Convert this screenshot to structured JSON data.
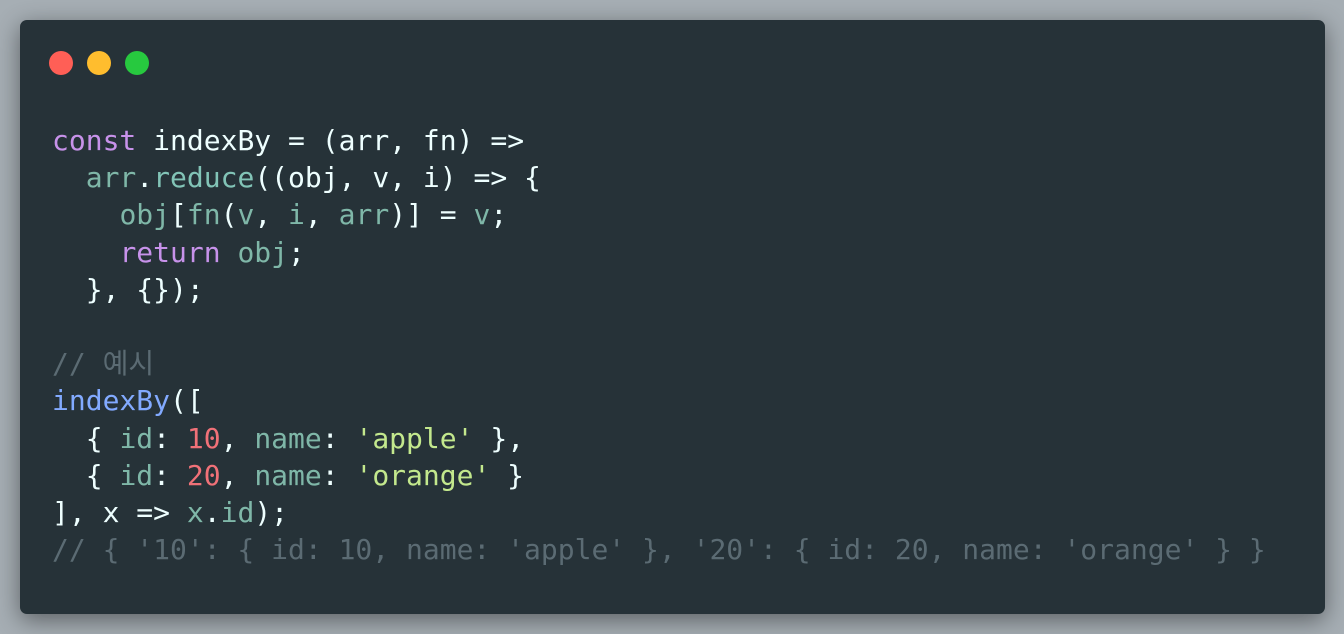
{
  "window": {
    "controls": [
      "close",
      "minimize",
      "maximize"
    ],
    "colors": {
      "close": "#ff5f56",
      "minimize": "#ffbd2e",
      "maximize": "#27c93f",
      "background": "#263238"
    }
  },
  "code": {
    "language": "javascript",
    "tokens": {
      "l1": [
        "const",
        " ",
        "indexBy",
        " = (",
        "arr",
        ", ",
        "fn",
        ") =>"
      ],
      "l2": [
        "  ",
        "arr",
        ".",
        "reduce",
        "((",
        "obj",
        ", ",
        "v",
        ", ",
        "i",
        ") => {"
      ],
      "l3": [
        "    ",
        "obj",
        "[",
        "fn",
        "(",
        "v",
        ", ",
        "i",
        ", ",
        "arr",
        ")] = ",
        "v",
        ";"
      ],
      "l4": [
        "    ",
        "return",
        " ",
        "obj",
        ";"
      ],
      "l5": [
        "  }, {});"
      ],
      "l6": [
        ""
      ],
      "l7": [
        "// 예시"
      ],
      "l8": [
        "indexBy",
        "(["
      ],
      "l9": [
        "  { ",
        "id",
        ": ",
        "10",
        ", ",
        "name",
        ": ",
        "'apple'",
        " },"
      ],
      "l10": [
        "  { ",
        "id",
        ": ",
        "20",
        ", ",
        "name",
        ": ",
        "'orange'",
        " }"
      ],
      "l11": [
        "], ",
        "x",
        " => ",
        "x",
        ".",
        "id",
        ");"
      ],
      "l12": [
        "// { '10': { id: 10, name: 'apple' }, '20': { id: 20, name: 'orange' } }"
      ]
    }
  }
}
